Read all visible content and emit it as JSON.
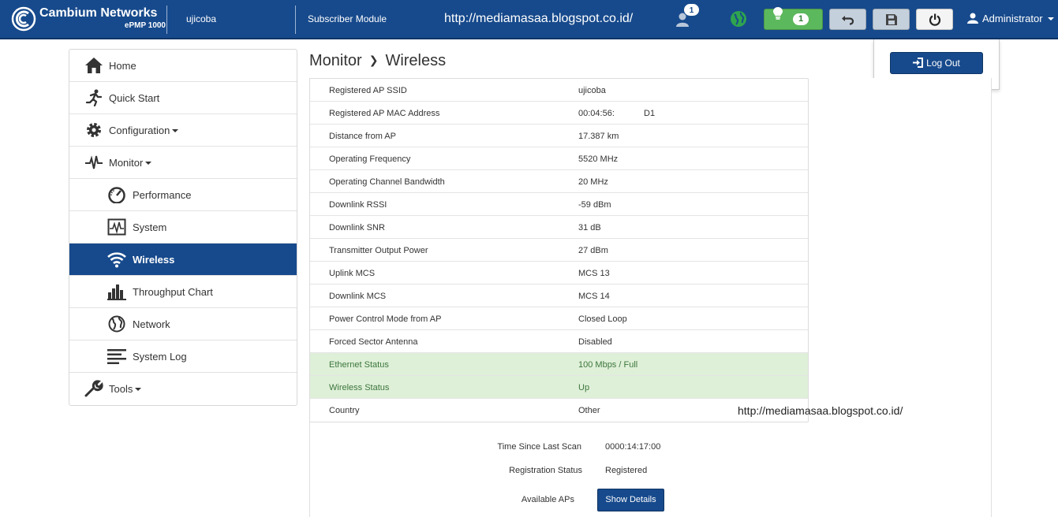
{
  "topbar": {
    "brand_name": "Cambium Networks",
    "brand_model": "ePMP 1000",
    "device_name": "ujicoba",
    "device_mode": "Subscriber Module",
    "watermark_url": "http://mediamasaa.blogspot.co.id/",
    "user_badge_count": "1",
    "alert_count": "1",
    "admin_label": "Administrator",
    "icons": [
      "cambium-logo-icon",
      "users-icon",
      "globe-icon",
      "lightbulb-icon",
      "undo-icon",
      "save-icon",
      "power-icon",
      "user-icon"
    ],
    "colors": {
      "bar": "#174a8c",
      "green": "#5cb85c",
      "globe": "#2ea44f"
    }
  },
  "logout": {
    "label": "Log Out"
  },
  "sidebar": {
    "items": [
      {
        "label": "Home",
        "icon": "home-icon",
        "caret": false
      },
      {
        "label": "Quick Start",
        "icon": "running-icon",
        "caret": false
      },
      {
        "label": "Configuration",
        "icon": "gear-icon",
        "caret": true
      },
      {
        "label": "Monitor",
        "icon": "pulse-icon",
        "caret": true
      },
      {
        "label": "Performance",
        "icon": "gauge-icon",
        "caret": false
      },
      {
        "label": "System",
        "icon": "system-monitor-icon",
        "caret": false
      },
      {
        "label": "Wireless",
        "icon": "wifi-icon",
        "caret": false,
        "active": true
      },
      {
        "label": "Throughput Chart",
        "icon": "bar-chart-icon",
        "caret": false
      },
      {
        "label": "Network",
        "icon": "globe-icon",
        "caret": false
      },
      {
        "label": "System Log",
        "icon": "list-icon",
        "caret": false
      },
      {
        "label": "Tools",
        "icon": "wrench-icon",
        "caret": true
      }
    ]
  },
  "breadcrumb": {
    "parent": "Monitor",
    "current": "Wireless"
  },
  "wireless": {
    "rows": [
      {
        "label": "Registered AP SSID",
        "value": "ujicoba",
        "extra": ""
      },
      {
        "label": "Registered AP MAC Address",
        "value": "00:04:56:",
        "extra": "D1"
      },
      {
        "label": "Distance from AP",
        "value": "17.387 km",
        "extra": ""
      },
      {
        "label": "Operating Frequency",
        "value": "5520 MHz",
        "extra": ""
      },
      {
        "label": "Operating Channel Bandwidth",
        "value": "20 MHz",
        "extra": ""
      },
      {
        "label": "Downlink RSSI",
        "value": "-59 dBm",
        "extra": ""
      },
      {
        "label": "Downlink SNR",
        "value": "31 dB",
        "extra": ""
      },
      {
        "label": "Transmitter Output Power",
        "value": "27 dBm",
        "extra": ""
      },
      {
        "label": "Uplink MCS",
        "value": "MCS 13",
        "extra": ""
      },
      {
        "label": "Downlink MCS",
        "value": "MCS 14",
        "extra": ""
      },
      {
        "label": "Power Control Mode from AP",
        "value": "Closed Loop",
        "extra": ""
      },
      {
        "label": "Forced Sector Antenna",
        "value": "Disabled",
        "extra": ""
      },
      {
        "label": "Ethernet Status",
        "value": "100 Mbps / Full",
        "extra": "",
        "status": "ok"
      },
      {
        "label": "Wireless Status",
        "value": "Up",
        "extra": "",
        "status": "ok"
      },
      {
        "label": "Country",
        "value": "Other",
        "extra": ""
      }
    ]
  },
  "watermark2": "http://mediamasaa.blogspot.co.id/",
  "scan": {
    "time_label": "Time Since Last Scan",
    "time_value": "0000:14:17:00",
    "reg_label": "Registration Status",
    "reg_value": "Registered",
    "aps_label": "Available APs",
    "show_details": "Show Details"
  }
}
